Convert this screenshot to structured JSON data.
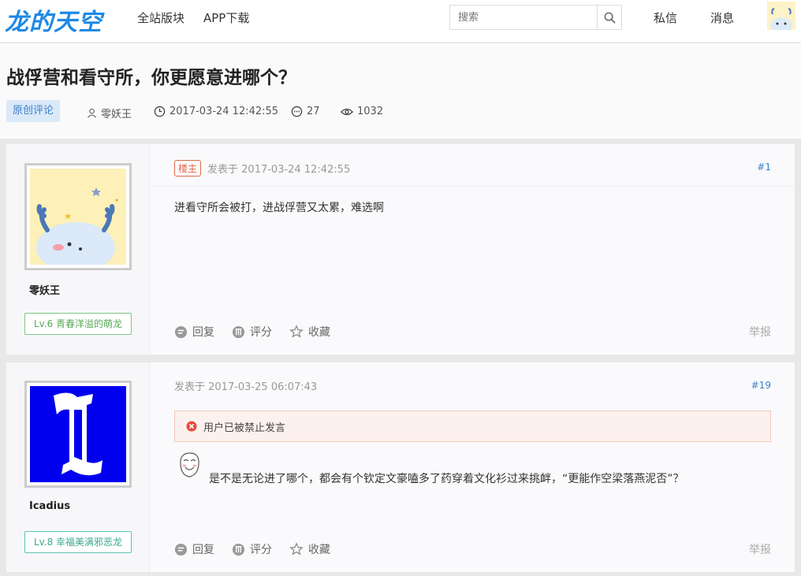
{
  "header": {
    "logo": "龙的天空",
    "nav": [
      "全站版块",
      "APP下载"
    ],
    "search_placeholder": "搜索",
    "messages": "私信",
    "notifications": "消息"
  },
  "thread": {
    "title": "战俘营和看守所，你更愿意进哪个？",
    "tag": "原创评论",
    "author": "零妖王",
    "datetime": "2017-03-24 12:42:55",
    "comments": "27",
    "views": "1032"
  },
  "posts": [
    {
      "username": "零妖王",
      "level": "Lv.6 青春洋溢的萌龙",
      "op_badge": "楼主",
      "posted": "发表于 2017-03-24 12:42:55",
      "floor": "#1",
      "content": "进看守所会被打，进战俘营又太累，难选啊",
      "reply": "回复",
      "rate": "评分",
      "favorite": "收藏",
      "report": "举报"
    },
    {
      "username": "Icadius",
      "level": "Lv.8 幸福美满邪恶龙",
      "posted": "发表于 2017-03-25 06:07:43",
      "floor": "#19",
      "banned_notice": "用户已被禁止发言",
      "content": "是不是无论进了哪个，都会有个钦定文豪嗑多了药穿着文化衫过来挑衅，“更能作空梁落燕泥否”？",
      "reply": "回复",
      "rate": "评分",
      "favorite": "收藏",
      "report": "举报"
    }
  ],
  "colors": {
    "brand": "#1e88e5",
    "tag_bg": "#dbe9f8",
    "link": "#3a7fc8",
    "op_badge": "#e2684a",
    "banned_bg": "#fdf1ee"
  }
}
